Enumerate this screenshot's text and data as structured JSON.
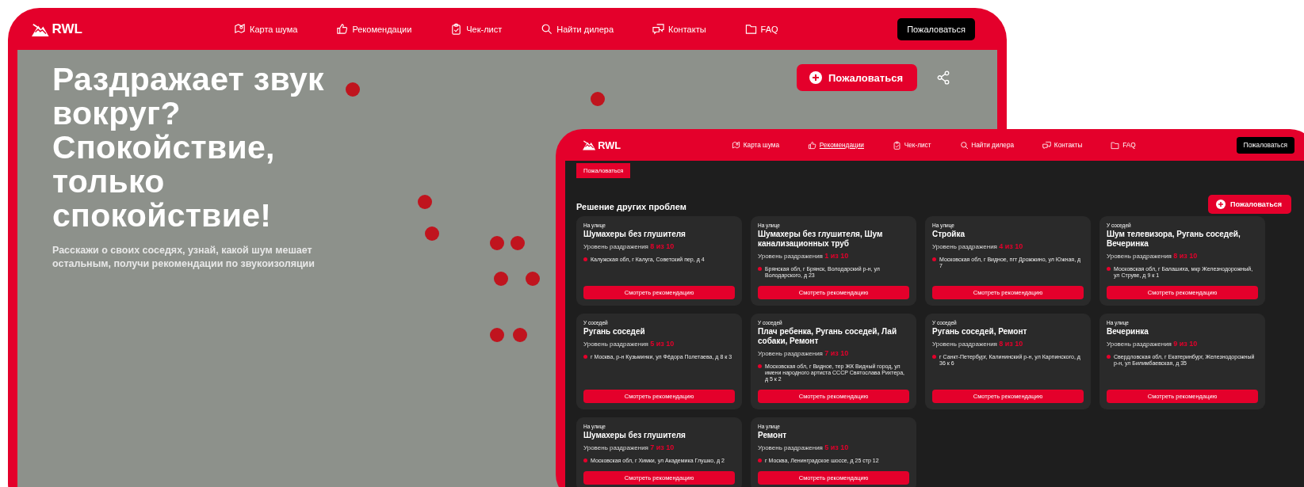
{
  "back_window": {
    "logo": "RWL",
    "nav": [
      {
        "label": "Карта шума",
        "selected": false
      },
      {
        "label": "Рекомендации",
        "selected": false
      },
      {
        "label": "Чек-лист",
        "selected": false
      },
      {
        "label": "Найти дилера",
        "selected": false
      },
      {
        "label": "Контакты",
        "selected": false
      },
      {
        "label": "FAQ",
        "selected": false
      }
    ],
    "complain_button": "Пожаловаться",
    "hero": {
      "title": "Раздражает звук вокруг? Спокойствие, только спокойствие!",
      "subtitle": "Расскажи о своих соседях, узнай, какой шум мешает остальным, получи рекомендации по звукоизоляции"
    },
    "action_button": "Пожаловаться"
  },
  "front_window": {
    "logo": "RWL",
    "nav": [
      {
        "label": "Карта шума",
        "selected": false
      },
      {
        "label": "Рекомендации",
        "selected": true
      },
      {
        "label": "Чек-лист",
        "selected": false
      },
      {
        "label": "Найти дилера",
        "selected": false
      },
      {
        "label": "Контакты",
        "selected": false
      },
      {
        "label": "FAQ",
        "selected": false
      }
    ],
    "complain_button": "Пожаловаться",
    "tag_button": "Пожаловаться",
    "action_button": "Пожаловаться",
    "section_title": "Решение других проблем",
    "cards": [
      {
        "category": "На улице",
        "title": "Шумахеры без глушителя",
        "level": "Уровень раздражения **8 из 10**",
        "address": "Калужская обл, г Калуга, Советский пер, д 4",
        "button": "Смотреть рекомендацию"
      },
      {
        "category": "На улице",
        "title": "Шумахеры без глушителя, Шум канализационных труб",
        "level": "Уровень раздражения **1 из 10**",
        "address": "Брянская обл, г Брянск, Володарский р-н, ул Володарского, д 23",
        "button": "Смотреть рекомендацию"
      },
      {
        "category": "На улице",
        "title": "Стройка",
        "level": "Уровень раздражения **4 из 10**",
        "address": "Московская обл, г Видное, пгт Дрожжино, ул Южная, д 7",
        "button": "Смотреть рекомендацию"
      },
      {
        "category": "У соседей",
        "title": "Шум телевизора, Ругань соседей, Вечеринка",
        "level": "Уровень раздражения **8 из 10**",
        "address": "Московская обл, г Балашиха, мкр Железнодорожный, ул Струве, д 9 к 1",
        "button": "Смотреть рекомендацию"
      },
      {
        "category": "У соседей",
        "title": "Ругань соседей",
        "level": "Уровень раздражения **5 из 10**",
        "address": "г Москва, р-н Кузьминки, ул Фёдора Полетаева, д 8 к 3",
        "button": "Смотреть рекомендацию"
      },
      {
        "category": "У соседей",
        "title": "Плач ребенка, Ругань соседей, Лай собаки, Ремонт",
        "level": "Уровень раздражения **7 из 10**",
        "address": "Московская обл, г Видное, тер ЖК Видный город, ул имени народного артиста СССР Святослава Рихтера, д 5 к 2",
        "button": "Смотреть рекомендацию"
      },
      {
        "category": "У соседей",
        "title": "Ругань соседей, Ремонт",
        "level": "Уровень раздражения **8 из 10**",
        "address": "г Санкт-Петербург, Калининский р-н, ул Карпинского, д 36 к 6",
        "button": "Смотреть рекомендацию"
      },
      {
        "category": "На улице",
        "title": "Вечеринка",
        "level": "Уровень раздражения **9 из 10**",
        "address": "Свердловская обл, г Екатеринбург, Железнодорожный р-н, ул Билимбаевская, д 35",
        "button": "Смотреть рекомендацию"
      },
      {
        "category": "На улице",
        "title": "Шумахеры без глушителя",
        "level": "Уровень раздражения **7 из 10**",
        "address": "Московская обл, г Химки, ул Академика Глушко, д 2",
        "button": "Смотреть рекомендацию"
      },
      {
        "category": "На улице",
        "title": "Ремонт",
        "level": "Уровень раздражения **5 из 10**",
        "address": "г Москва, Ленинградское шоссе, д 25 стр 12",
        "button": "Смотреть рекомендацию"
      }
    ]
  }
}
